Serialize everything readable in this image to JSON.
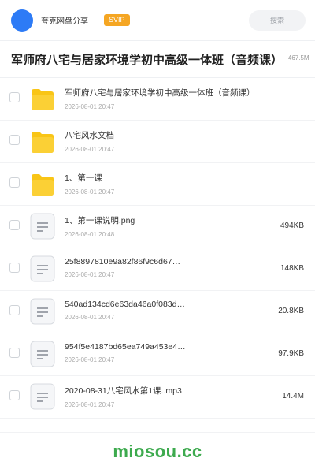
{
  "header": {
    "app_name": "夸克网盘分享",
    "badge": "SVIP",
    "search_placeholder": "搜索"
  },
  "share": {
    "title": "军师府八宅与居家环境学初中高级一体班（音频课）",
    "size": "· 467.5M"
  },
  "files": [
    {
      "type": "folder",
      "name": "军师府八宅与居家环境学初中高级一体班（音频课）",
      "date": "2026-08-01 20:47",
      "size": ""
    },
    {
      "type": "folder",
      "name": "八宅风水文档",
      "date": "2026-08-01 20:47",
      "size": ""
    },
    {
      "type": "folder",
      "name": "1、第一课",
      "date": "2026-08-01 20:47",
      "size": ""
    },
    {
      "type": "file",
      "name": "1、第一课说明.png",
      "date": "2026-08-01 20:48",
      "size": "494KB"
    },
    {
      "type": "file",
      "name": "25f8897810e9a82f86f9c6d67…",
      "date": "2026-08-01 20:47",
      "size": "148KB"
    },
    {
      "type": "file",
      "name": "540ad134cd6e63da46a0f083d…",
      "date": "2026-08-01 20:47",
      "size": "20.8KB"
    },
    {
      "type": "file",
      "name": "954f5e4187bd65ea749a453e4…",
      "date": "2026-08-01 20:47",
      "size": "97.9KB"
    },
    {
      "type": "file",
      "name": "2020-08-31八宅风水第1课..mp3",
      "date": "2026-08-01 20:47",
      "size": "14.4M"
    }
  ],
  "watermark": "miosou.cc",
  "colors": {
    "accent": "#2d7bf6",
    "svip": "#f5a623",
    "folder": "#f9c516",
    "watermark": "#3daa4e"
  }
}
